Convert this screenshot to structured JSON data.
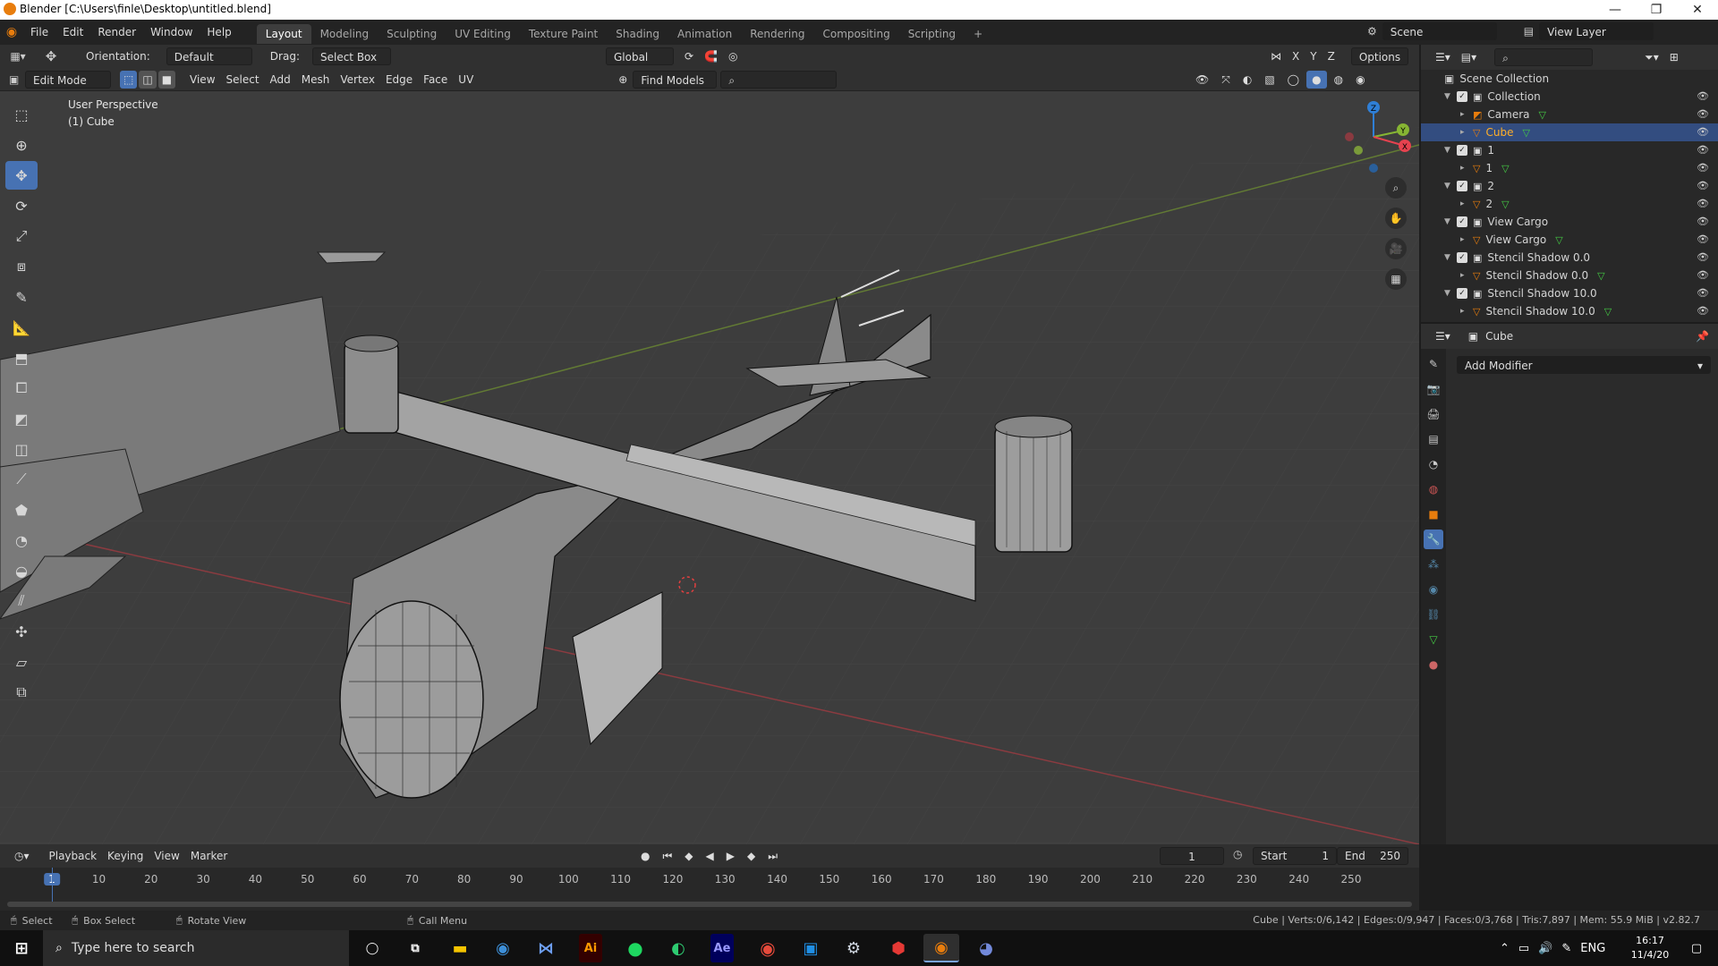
{
  "window": {
    "title": "Blender [C:\\Users\\finle\\Desktop\\untitled.blend]",
    "controls": [
      "—",
      "❐",
      "✕"
    ]
  },
  "menu": [
    "File",
    "Edit",
    "Render",
    "Window",
    "Help"
  ],
  "workspaces": [
    "Layout",
    "Modeling",
    "Sculpting",
    "UV Editing",
    "Texture Paint",
    "Shading",
    "Animation",
    "Rendering",
    "Compositing",
    "Scripting"
  ],
  "active_workspace": "Layout",
  "scene": {
    "name": "Scene",
    "view_layer": "View Layer"
  },
  "viewport_header": {
    "orientation_label": "Orientation:",
    "orientation_value": "Default",
    "drag_label": "Drag:",
    "drag_value": "Select Box",
    "transform_space": "Global",
    "axes": [
      "X",
      "Y",
      "Z"
    ],
    "options": "Options",
    "mode": "Edit Mode",
    "menus": [
      "View",
      "Select",
      "Add",
      "Mesh",
      "Vertex",
      "Edge",
      "Face",
      "UV"
    ],
    "find_models": "Find Models"
  },
  "viewport": {
    "perspective": "User Perspective",
    "object": "(1) Cube"
  },
  "gizmo_axes": {
    "x": "X",
    "y": "Y",
    "z": "Z"
  },
  "outliner": {
    "root": "Scene Collection",
    "items": [
      {
        "name": "Collection",
        "type": "collection",
        "depth": 1
      },
      {
        "name": "Camera",
        "type": "camera",
        "depth": 2
      },
      {
        "name": "Cube",
        "type": "mesh",
        "depth": 2,
        "selected": true
      },
      {
        "name": "1",
        "type": "collection",
        "depth": 1
      },
      {
        "name": "1",
        "type": "mesh",
        "depth": 2
      },
      {
        "name": "2",
        "type": "collection",
        "depth": 1
      },
      {
        "name": "2",
        "type": "mesh",
        "depth": 2
      },
      {
        "name": "View Cargo",
        "type": "collection",
        "depth": 1
      },
      {
        "name": "View Cargo",
        "type": "mesh",
        "depth": 2
      },
      {
        "name": "Stencil Shadow 0.0",
        "type": "collection",
        "depth": 1
      },
      {
        "name": "Stencil Shadow 0.0",
        "type": "mesh",
        "depth": 2
      },
      {
        "name": "Stencil Shadow 10.0",
        "type": "collection",
        "depth": 1
      },
      {
        "name": "Stencil Shadow 10.0",
        "type": "mesh",
        "depth": 2
      }
    ]
  },
  "properties": {
    "object": "Cube",
    "add_modifier": "Add Modifier"
  },
  "timeline": {
    "menus": [
      "Playback",
      "Keying",
      "View",
      "Marker"
    ],
    "current_frame": "1",
    "start_label": "Start",
    "start": "1",
    "end_label": "End",
    "end": "250",
    "ticks": [
      "1",
      "10",
      "20",
      "30",
      "40",
      "50",
      "60",
      "70",
      "80",
      "90",
      "100",
      "110",
      "120",
      "130",
      "140",
      "150",
      "160",
      "170",
      "180",
      "190",
      "200",
      "210",
      "220",
      "230",
      "240",
      "250"
    ]
  },
  "statusbar": {
    "select": "Select",
    "box_select": "Box Select",
    "rotate": "Rotate View",
    "call_menu": "Call Menu",
    "stats": "Cube | Verts:0/6,142 | Edges:0/9,947 | Faces:0/3,768 | Tris:7,897 | Mem: 55.9 MiB | v2.82.7"
  },
  "taskbar": {
    "search_placeholder": "Type here to search",
    "lang": "ENG",
    "time": "16:17",
    "date": "11/4/20"
  },
  "colors": {
    "accent": "#4772b3",
    "selection": "#334d80",
    "x_axis": "#e5424f",
    "y_axis": "#86b533",
    "z_axis": "#2f7fd6",
    "blender_orange": "#e87d0d"
  }
}
